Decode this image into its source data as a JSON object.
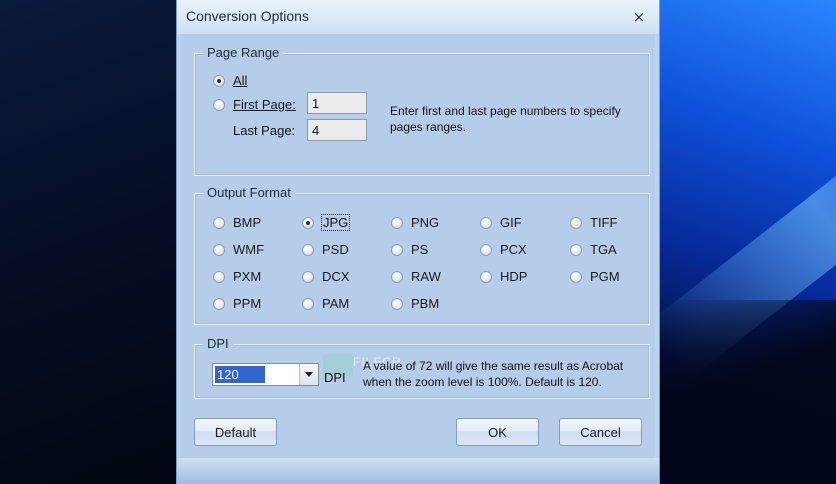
{
  "window": {
    "title": "Conversion Options",
    "close_glyph": "×"
  },
  "page_range": {
    "legend": "Page Range",
    "all_label": "All",
    "first_page_label": "First Page:",
    "last_page_label": "Last Page:",
    "first_page_value": "1",
    "last_page_value": "4",
    "hint": "Enter first and last page numbers to specify pages ranges.",
    "selected": "All"
  },
  "output_format": {
    "legend": "Output Format",
    "selected": "JPG",
    "options": [
      [
        "BMP",
        "JPG",
        "PNG",
        "GIF",
        "TIFF"
      ],
      [
        "WMF",
        "PSD",
        "PS",
        "PCX",
        "TGA"
      ],
      [
        "PXM",
        "DCX",
        "RAW",
        "HDP",
        "PGM"
      ],
      [
        "PPM",
        "PAM",
        "PBM"
      ]
    ]
  },
  "dpi": {
    "legend": "DPI",
    "value": "120",
    "unit": "DPI",
    "hint": "A value of 72 will give the same result as Acrobat when the zoom level is 100%. Default is 120."
  },
  "buttons": {
    "default": "Default",
    "ok": "OK",
    "cancel": "Cancel"
  },
  "watermark": {
    "text": "FILECR"
  },
  "colors": {
    "accent": "#3266cc",
    "dialog_bg": "#b5cde9",
    "desktop_blue": "#0e4fd8"
  }
}
